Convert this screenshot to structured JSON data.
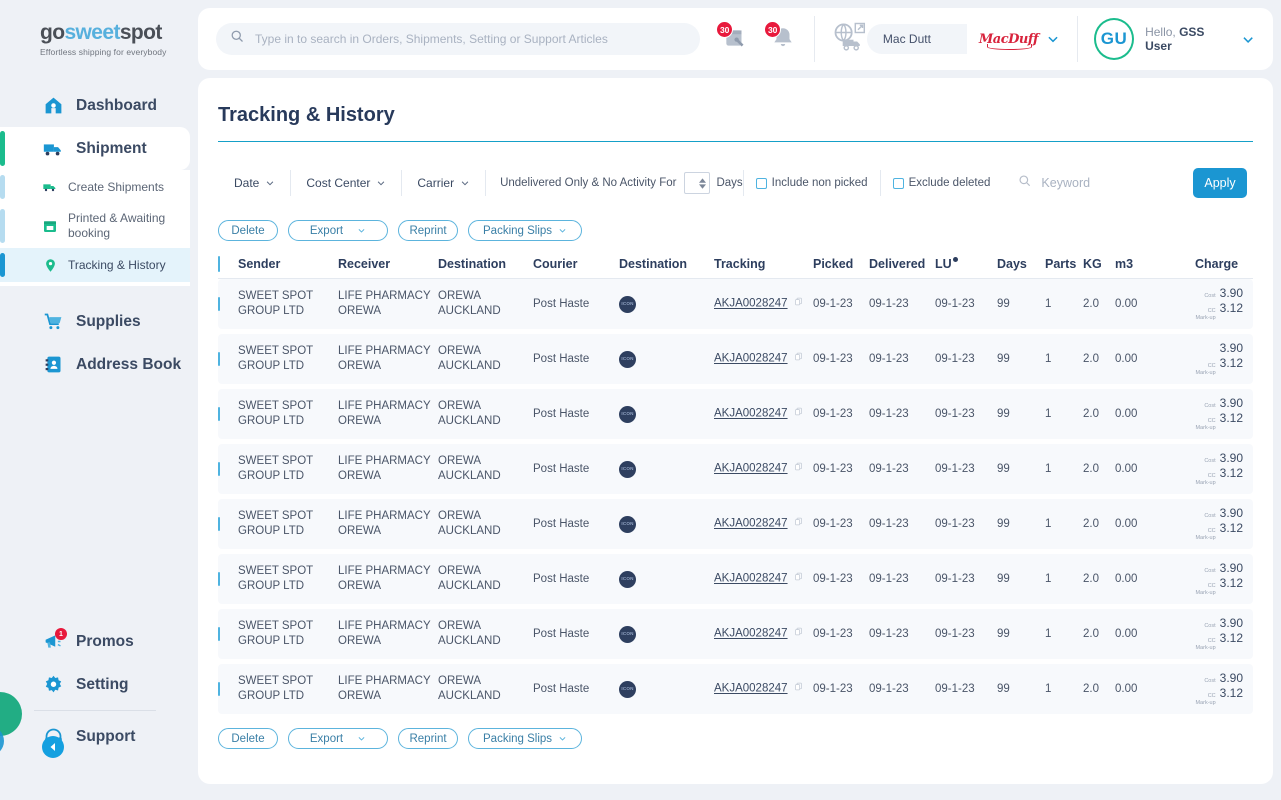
{
  "brand": {
    "logo_go": "go",
    "logo_sweet": "sweet",
    "logo_spot": "spot",
    "tagline": "Effortless shipping for everybody",
    "accent_blue": "#1b96d2",
    "accent_green": "#1bbc8d",
    "badge_red": "#e8193c"
  },
  "sidebar": {
    "main": [
      {
        "label": "Dashboard",
        "icon": "home-icon"
      },
      {
        "label": "Shipment",
        "icon": "truck-icon"
      }
    ],
    "sub_items": [
      {
        "label": "Create Shipments",
        "icon": "create-shipment-icon"
      },
      {
        "label": "Printed & Awaiting booking",
        "icon": "calendar-icon"
      },
      {
        "label": "Tracking & History",
        "icon": "location-pin-icon"
      }
    ],
    "lower": [
      {
        "label": "Supplies",
        "icon": "cart-icon"
      },
      {
        "label": "Address Book",
        "icon": "address-book-icon"
      }
    ],
    "bottom": [
      {
        "label": "Promos",
        "icon": "megaphone-icon",
        "badge": "1"
      },
      {
        "label": "Setting",
        "icon": "gear-icon",
        "badge": ""
      },
      {
        "label": "Support",
        "icon": "headset-icon",
        "badge": ""
      }
    ]
  },
  "topbar": {
    "search_placeholder": "Type in to search in Orders, Shipments, Setting or Support Articles",
    "search_value": "",
    "orders_badge": "30",
    "bell_badge": "30",
    "account_name": "Mac Dutt",
    "account_brand": "MacDuff",
    "avatar_initials": "GU",
    "greeting_prefix": "Hello, ",
    "greeting_user": "GSS User"
  },
  "page": {
    "title": "Tracking & History"
  },
  "filters": {
    "date_label": "Date",
    "cost_center_label": "Cost Center",
    "carrier_label": "Carrier",
    "undelivered_label": "Undelivered Only & No Activity For",
    "days_value": "",
    "days_suffix": "Days",
    "include_non_picked": "Include non picked",
    "exclude_deleted": "Exclude deleted",
    "keyword_placeholder": "Keyword",
    "keyword_value": "",
    "apply_label": "Apply"
  },
  "actions": {
    "delete_label": "Delete",
    "export_label": "Export",
    "reprint_label": "Reprint",
    "packing_slips_label": "Packing Slips"
  },
  "table": {
    "columns": [
      "Sender",
      "Receiver",
      "Destination",
      "Courier",
      "Destination",
      "Tracking",
      "Picked",
      "Delivered",
      "LU",
      "Days",
      "Parts",
      "KG",
      "m3",
      "Charge"
    ],
    "rows": [
      {
        "sender": "SWEET SPOT GROUP LTD",
        "receiver": "LIFE PHARMACY OREWA",
        "destination": "OREWA AUCKLAND",
        "courier": "Post Haste",
        "dest_icon": "ICON",
        "tracking": "AKJA0028247",
        "picked": "09-1-23",
        "delivered": "09-1-23",
        "lu": "09-1-23",
        "days": "99",
        "parts": "1",
        "kg": "2.0",
        "m3": "0.00",
        "cost_label": "Cost",
        "cost_value": "3.90",
        "markup_label": "CC Mark-up",
        "markup_value": "3.12"
      },
      {
        "sender": "SWEET SPOT GROUP LTD",
        "receiver": "LIFE PHARMACY OREWA",
        "destination": "OREWA AUCKLAND",
        "courier": "Post Haste",
        "dest_icon": "ICON",
        "tracking": "AKJA0028247",
        "picked": "09-1-23",
        "delivered": "09-1-23",
        "lu": "09-1-23",
        "days": "99",
        "parts": "1",
        "kg": "2.0",
        "m3": "0.00",
        "cost_label": "",
        "cost_value": "3.90",
        "markup_label": "CC Mark-up",
        "markup_value": "3.12"
      },
      {
        "sender": "SWEET SPOT GROUP LTD",
        "receiver": "LIFE PHARMACY OREWA",
        "destination": "OREWA AUCKLAND",
        "courier": "Post Haste",
        "dest_icon": "ICON",
        "tracking": "AKJA0028247",
        "picked": "09-1-23",
        "delivered": "09-1-23",
        "lu": "09-1-23",
        "days": "99",
        "parts": "1",
        "kg": "2.0",
        "m3": "0.00",
        "cost_label": "Cost",
        "cost_value": "3.90",
        "markup_label": "CC Mark-up",
        "markup_value": "3.12"
      },
      {
        "sender": "SWEET SPOT GROUP LTD",
        "receiver": "LIFE PHARMACY OREWA",
        "destination": "OREWA AUCKLAND",
        "courier": "Post Haste",
        "dest_icon": "ICON",
        "tracking": "AKJA0028247",
        "picked": "09-1-23",
        "delivered": "09-1-23",
        "lu": "09-1-23",
        "days": "99",
        "parts": "1",
        "kg": "2.0",
        "m3": "0.00",
        "cost_label": "Cost",
        "cost_value": "3.90",
        "markup_label": "CC Mark-up",
        "markup_value": "3.12"
      },
      {
        "sender": "SWEET SPOT GROUP LTD",
        "receiver": "LIFE PHARMACY OREWA",
        "destination": "OREWA AUCKLAND",
        "courier": "Post Haste",
        "dest_icon": "ICON",
        "tracking": "AKJA0028247",
        "picked": "09-1-23",
        "delivered": "09-1-23",
        "lu": "09-1-23",
        "days": "99",
        "parts": "1",
        "kg": "2.0",
        "m3": "0.00",
        "cost_label": "Cost",
        "cost_value": "3.90",
        "markup_label": "CC Mark-up",
        "markup_value": "3.12"
      },
      {
        "sender": "SWEET SPOT GROUP LTD",
        "receiver": "LIFE PHARMACY OREWA",
        "destination": "OREWA AUCKLAND",
        "courier": "Post Haste",
        "dest_icon": "ICON",
        "tracking": "AKJA0028247",
        "picked": "09-1-23",
        "delivered": "09-1-23",
        "lu": "09-1-23",
        "days": "99",
        "parts": "1",
        "kg": "2.0",
        "m3": "0.00",
        "cost_label": "Cost",
        "cost_value": "3.90",
        "markup_label": "CC Mark-up",
        "markup_value": "3.12"
      },
      {
        "sender": "SWEET SPOT GROUP LTD",
        "receiver": "LIFE PHARMACY OREWA",
        "destination": "OREWA AUCKLAND",
        "courier": "Post Haste",
        "dest_icon": "ICON",
        "tracking": "AKJA0028247",
        "picked": "09-1-23",
        "delivered": "09-1-23",
        "lu": "09-1-23",
        "days": "99",
        "parts": "1",
        "kg": "2.0",
        "m3": "0.00",
        "cost_label": "Cost",
        "cost_value": "3.90",
        "markup_label": "CC Mark-up",
        "markup_value": "3.12"
      },
      {
        "sender": "SWEET SPOT GROUP LTD",
        "receiver": "LIFE PHARMACY OREWA",
        "destination": "OREWA AUCKLAND",
        "courier": "Post Haste",
        "dest_icon": "ICON",
        "tracking": "AKJA0028247",
        "picked": "09-1-23",
        "delivered": "09-1-23",
        "lu": "09-1-23",
        "days": "99",
        "parts": "1",
        "kg": "2.0",
        "m3": "0.00",
        "cost_label": "Cost",
        "cost_value": "3.90",
        "markup_label": "CC Mark-up",
        "markup_value": "3.12"
      }
    ]
  }
}
